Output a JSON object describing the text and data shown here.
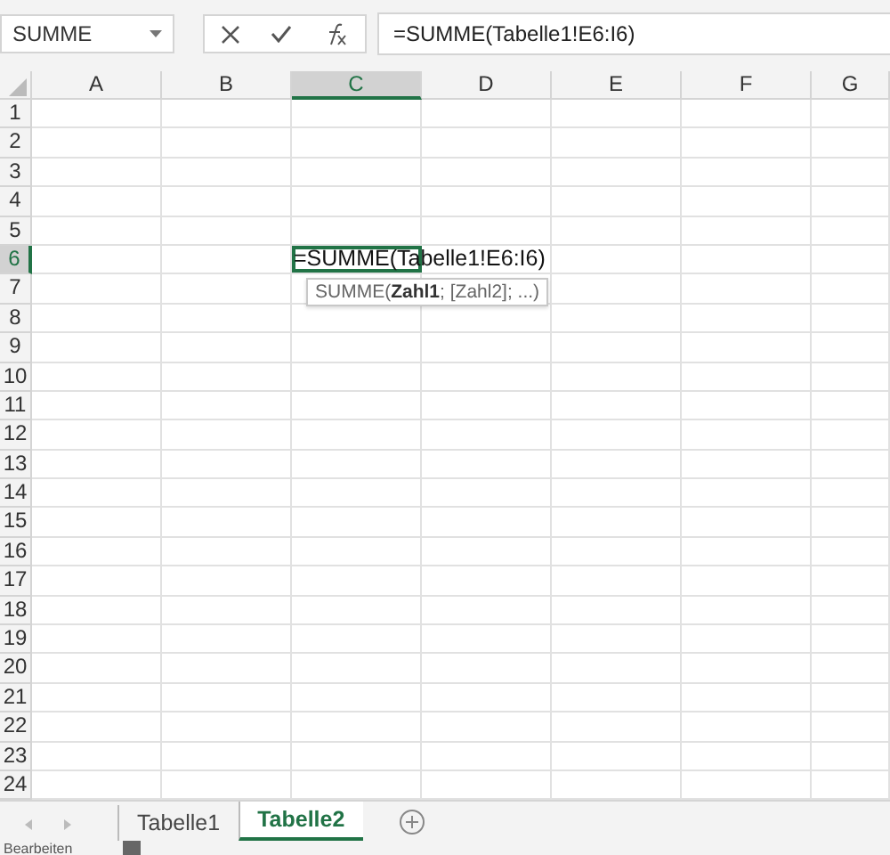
{
  "name_box": "SUMME",
  "formula_bar": {
    "value": "=SUMME(Tabelle1!E6:I6)"
  },
  "columns": [
    {
      "label": "A",
      "selected": false
    },
    {
      "label": "B",
      "selected": false
    },
    {
      "label": "C",
      "selected": true
    },
    {
      "label": "D",
      "selected": false
    },
    {
      "label": "E",
      "selected": false
    },
    {
      "label": "F",
      "selected": false
    },
    {
      "label": "G",
      "selected": false
    }
  ],
  "rows": [
    {
      "label": "1",
      "selected": false
    },
    {
      "label": "2",
      "selected": false
    },
    {
      "label": "3",
      "selected": false
    },
    {
      "label": "4",
      "selected": false
    },
    {
      "label": "5",
      "selected": false
    },
    {
      "label": "6",
      "selected": true
    },
    {
      "label": "7",
      "selected": false
    },
    {
      "label": "8",
      "selected": false
    },
    {
      "label": "9",
      "selected": false
    },
    {
      "label": "10",
      "selected": false
    },
    {
      "label": "11",
      "selected": false
    },
    {
      "label": "12",
      "selected": false
    },
    {
      "label": "13",
      "selected": false
    },
    {
      "label": "14",
      "selected": false
    },
    {
      "label": "15",
      "selected": false
    },
    {
      "label": "16",
      "selected": false
    },
    {
      "label": "17",
      "selected": false
    },
    {
      "label": "18",
      "selected": false
    },
    {
      "label": "19",
      "selected": false
    },
    {
      "label": "20",
      "selected": false
    },
    {
      "label": "21",
      "selected": false
    },
    {
      "label": "22",
      "selected": false
    },
    {
      "label": "23",
      "selected": false
    },
    {
      "label": "24",
      "selected": false
    }
  ],
  "active_cell": {
    "value": "=SUMME(Tabelle1!E6:I6)",
    "tooltip": "SUMME(**Zahl1**; [Zahl2]; ...)"
  },
  "sheet_tabs": [
    {
      "label": "Tabelle1",
      "selected": false
    },
    {
      "label": "Tabelle2",
      "selected": true
    }
  ],
  "status_bar": "Bearbeiten"
}
